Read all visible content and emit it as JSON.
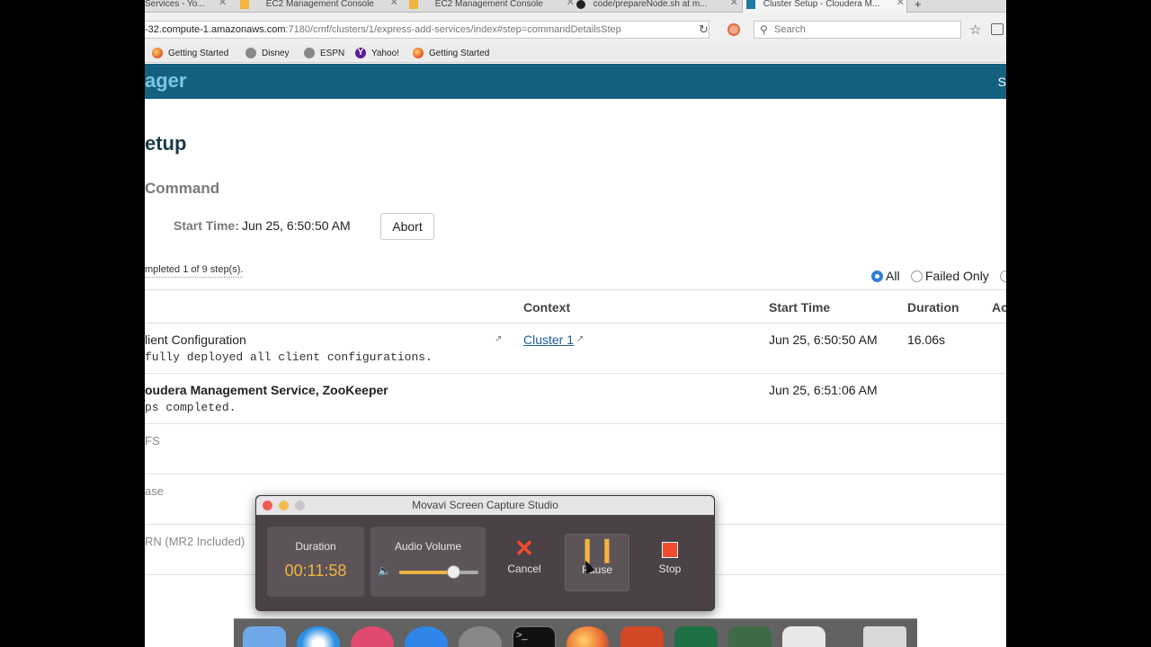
{
  "browser": {
    "tabs": [
      {
        "label": "Services - Yo...",
        "close": "✕"
      },
      {
        "label": "EC2 Management Console",
        "close": "✕"
      },
      {
        "label": "EC2 Management Console",
        "close": "✕"
      },
      {
        "label": "code/prepareNode.sh at m...",
        "close": "✕"
      },
      {
        "label": "Cluster Setup - Cloudera M...",
        "close": "✕"
      }
    ],
    "new_tab": "+",
    "url_host": "-32.compute-1.amazonaws.com",
    "url_path": ":7180/cmf/clusters/1/express-add-services/index#step=commandDetailsStep",
    "search_placeholder": "Search",
    "bookmarks": [
      "Getting Started",
      "Disney",
      "ESPN",
      "Yahoo!",
      "Getting Started"
    ]
  },
  "app": {
    "brand": "ager",
    "header_right": "S",
    "page_title": "etup",
    "command_title": "Command",
    "start_time_label": "Start Time:",
    "start_time_value": "Jun 25, 6:50:50 AM",
    "abort_label": "Abort",
    "progress_text": "mpleted 1 of 9 step(s).",
    "filters": {
      "all": "All",
      "failed_only": "Failed Only"
    },
    "columns": {
      "context": "Context",
      "start_time": "Start Time",
      "duration": "Duration",
      "actions": "Ac"
    },
    "rows": [
      {
        "name": "lient Configuration",
        "detail": "fully deployed all client configurations.",
        "context": "Cluster 1",
        "start": "Jun 25, 6:50:50 AM",
        "duration": "16.06s"
      },
      {
        "name": "oudera Management Service, ZooKeeper",
        "detail": "ps completed.",
        "context": "",
        "start": "Jun 25, 6:51:06 AM",
        "duration": ""
      },
      {
        "name": "FS",
        "detail": "",
        "context": "",
        "start": "",
        "duration": ""
      },
      {
        "name": "ase",
        "detail": "",
        "context": "",
        "start": "",
        "duration": ""
      },
      {
        "name": "RN (MR2 Included)",
        "detail": "",
        "context": "",
        "start": "",
        "duration": ""
      }
    ]
  },
  "movavi": {
    "title": "Movavi Screen Capture Studio",
    "duration_label": "Duration",
    "duration_value": "00:11:58",
    "audio_label": "Audio Volume",
    "volume": 0.68,
    "cancel_label": "Cancel",
    "pause_label": "Pause",
    "stop_label": "Stop",
    "accent": "#f1b441"
  }
}
